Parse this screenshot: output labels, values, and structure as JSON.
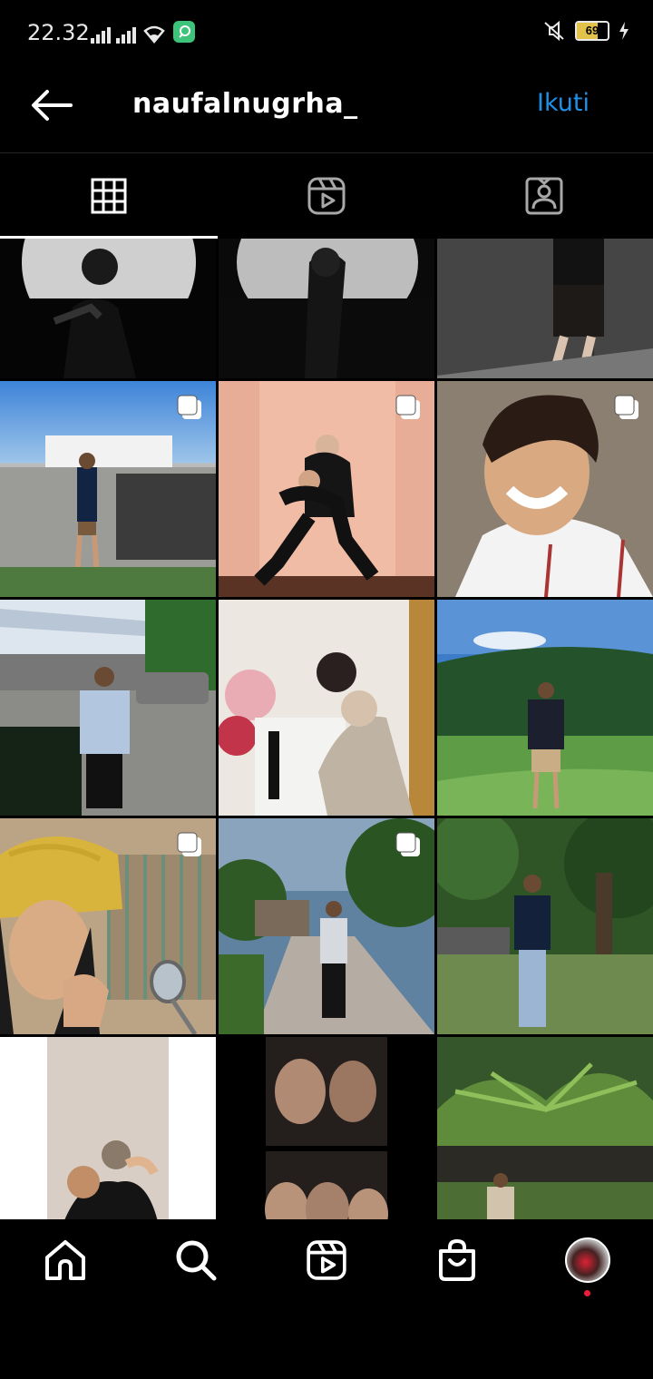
{
  "status": {
    "time": "22.32",
    "battery": "69",
    "battery_color": "#e2c24a"
  },
  "header": {
    "back_icon": "arrow-left-icon",
    "username": "naufalnugrha_",
    "follow_label": "Ikuti",
    "follow_color": "#1e90e8"
  },
  "tabs": [
    {
      "name": "posts",
      "icon": "grid-icon",
      "active": true
    },
    {
      "name": "reels",
      "icon": "reels-icon",
      "active": false
    },
    {
      "name": "tagged",
      "icon": "tagged-person-icon",
      "active": false
    }
  ],
  "grid": {
    "columns": 3,
    "posts": [
      {
        "subject": "man posing dark backdrop",
        "multi": false
      },
      {
        "subject": "silhouette dark backdrop",
        "multi": false
      },
      {
        "subject": "man against grey wall",
        "multi": false
      },
      {
        "subject": "man standing by white house",
        "multi": true
      },
      {
        "subject": "couple on pink backdrop",
        "multi": true
      },
      {
        "subject": "smiling man selfie",
        "multi": true
      },
      {
        "subject": "man in street",
        "multi": false
      },
      {
        "subject": "couple with flowers",
        "multi": false
      },
      {
        "subject": "man on green hills",
        "multi": false
      },
      {
        "subject": "helmet selfie",
        "multi": true
      },
      {
        "subject": "man on road with trees",
        "multi": true
      },
      {
        "subject": "man in garden",
        "multi": false
      },
      {
        "subject": "couple on white",
        "multi": false
      },
      {
        "subject": "photo strip",
        "multi": false
      },
      {
        "subject": "fern forest sign",
        "multi": false
      }
    ]
  },
  "bottom_nav": [
    {
      "name": "home",
      "icon": "home-icon"
    },
    {
      "name": "search",
      "icon": "search-icon"
    },
    {
      "name": "reels",
      "icon": "reels-icon"
    },
    {
      "name": "shop",
      "icon": "shop-bag-icon"
    },
    {
      "name": "profile",
      "icon": "avatar"
    }
  ]
}
